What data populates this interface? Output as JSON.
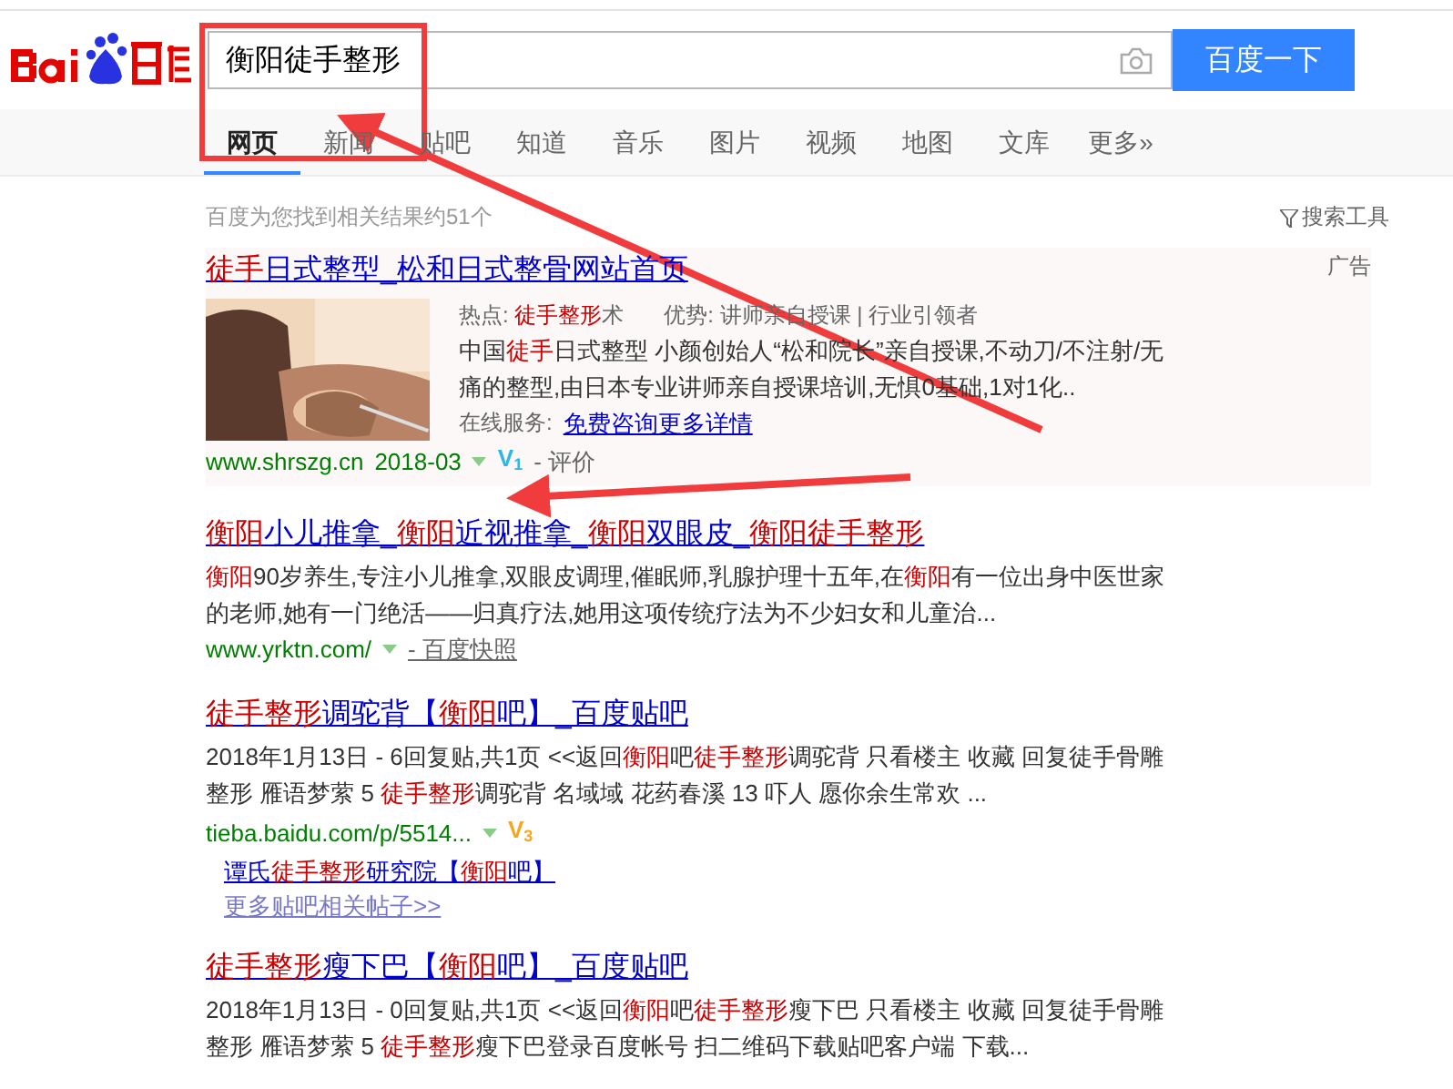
{
  "search": {
    "query": "衡阳徒手整形",
    "button": "百度一下"
  },
  "nav": [
    {
      "label": "网页",
      "selected": true
    },
    {
      "label": "新闻",
      "selected": false
    },
    {
      "label": "贴吧",
      "selected": false
    },
    {
      "label": "知道",
      "selected": false
    },
    {
      "label": "音乐",
      "selected": false
    },
    {
      "label": "图片",
      "selected": false
    },
    {
      "label": "视频",
      "selected": false
    },
    {
      "label": "地图",
      "selected": false
    },
    {
      "label": "文库",
      "selected": false
    },
    {
      "label": "更多»",
      "selected": false
    }
  ],
  "stats": "百度为您找到相关结果约51个",
  "tools": "搜索工具",
  "results": [
    {
      "kind": "ad",
      "title": "**徒手**日式整型_松和日式整骨网站首页",
      "ad_label": "广告",
      "hot": "热点: **徒手整形**术",
      "advantage": "优势: 讲师亲自授课 | 行业引领者",
      "description_lines": [
        "中国**徒手**日式整型 小颜创始人“松和院长”亲自授课,不动刀/不注射/无",
        "痛的整型,由日本专业讲师亲自授课培训,无惧0基础,1对1化.."
      ],
      "service_label": "在线服务:",
      "service_link": "免费咨询更多详情",
      "url": "www.shrszg.cn",
      "date": "2018-03",
      "badge": "V$_{1}$",
      "review": "- 评价"
    },
    {
      "kind": "organic",
      "title": "**衡阳**小儿推拿_**衡阳**近视推拿_**衡阳**双眼皮_**衡阳徒手整形**",
      "description_lines": [
        "**衡阳**90岁养生,专注小儿推拿,双眼皮调理,催眠师,乳腺护理十五年,在**衡阳**有一位出身中医世家",
        "的老师,她有一门绝活——归真疗法,她用这项传统疗法为不少妇女和儿童治..."
      ],
      "url": "www.yrktn.com/",
      "snapshot": "- 百度快照"
    },
    {
      "kind": "tieba",
      "title": "**徒手整形**调驼背【**衡阳**吧】_百度贴吧",
      "description_lines": [
        "2018年1月13日 - 6回复贴,共1页 <<返回**衡阳**吧**徒手整形**调驼背 只看楼主 收藏 回复徒手骨雕",
        "整形 雁语梦萦 5 **徒手整形**调驼背 名域域 花药春溪 13 吓人 愿你余生常欢 ..."
      ],
      "url": "tieba.baidu.com/p/5514...",
      "badge": "V$_{3}$",
      "sub_link": "谭氏**徒手整形**研究院【**衡阳**吧】",
      "more": "更多贴吧相关帖子>>"
    },
    {
      "kind": "tieba",
      "title": "**徒手整形**瘦下巴【**衡阳**吧】_百度贴吧",
      "description_lines": [
        "2018年1月13日 - 0回复贴,共1页 <<返回**衡阳**吧**徒手整形**瘦下巴 只看楼主 收藏 回复徒手骨雕",
        "整形 雁语梦萦 5 **徒手整形**瘦下巴登录百度帐号 扫二维码下载贴吧客户端 下载..."
      ]
    }
  ]
}
